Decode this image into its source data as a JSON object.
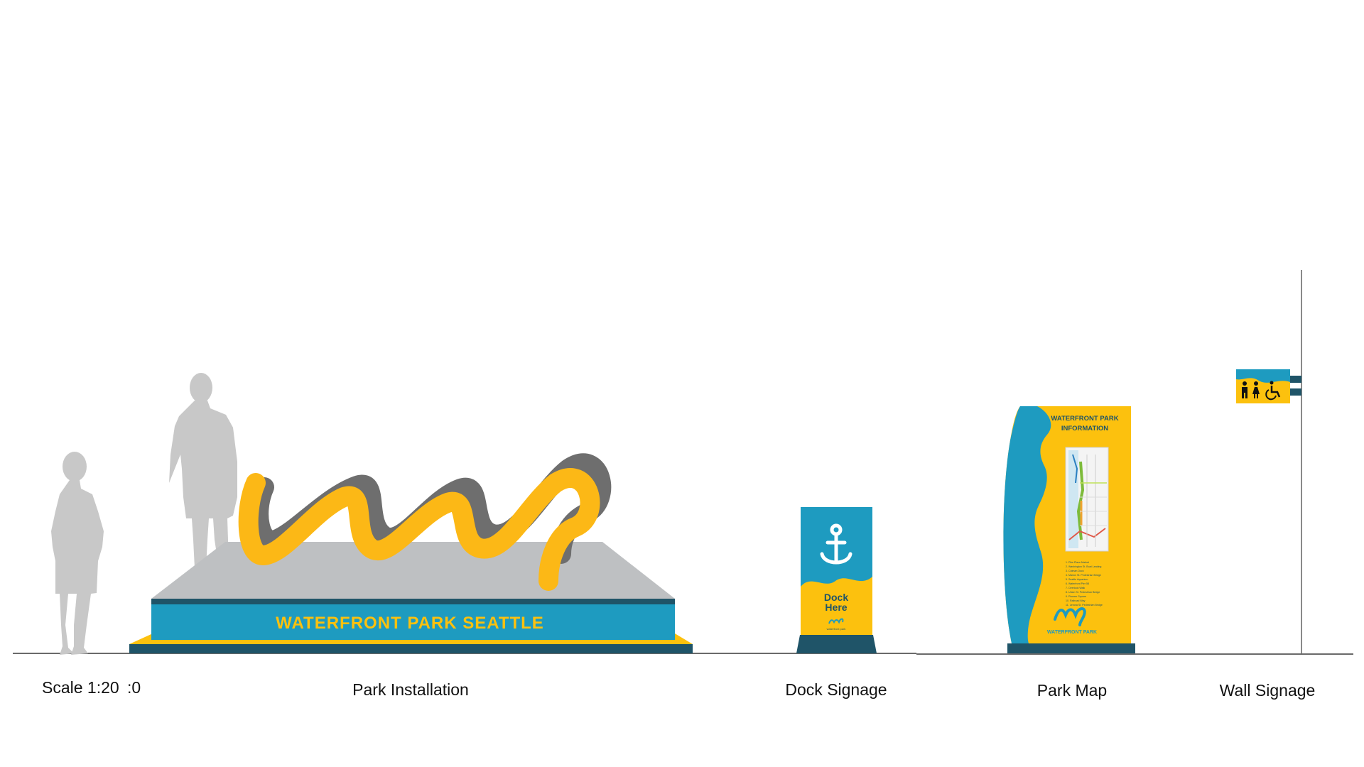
{
  "scale_label": "Scale 1:20",
  "scale_fragment": ":0",
  "captions": {
    "park_installation": "Park Installation",
    "dock_signage": "Dock Signage",
    "park_map": "Park Map",
    "wall_signage": "Wall Signage"
  },
  "installation": {
    "banner_text": "WATERFRONT PARK SEATTLE"
  },
  "dock_sign": {
    "line1": "Dock",
    "line2": "Here",
    "small_logo_caption": "waterfront park"
  },
  "map_kiosk": {
    "title_line1": "WATERFRONT PARK",
    "title_line2": "INFORMATION",
    "logo_caption": "WATERFRONT PARK",
    "legend_items": [
      "1. Pike Place Market",
      "2. Washington St. Boat Landing",
      "3. Colman Dock",
      "4. Marion St. Pedestrian Bridge",
      "5. Seattle Aquarium",
      "6. Waterfront Pier 58",
      "7. Overlook Walk",
      "8. Union St. Pedestrian Bridge",
      "9. Pioneer Square",
      "10. Railroad Way",
      "11. Lenora St. Pedestrian Bridge"
    ]
  },
  "wall_sign": {
    "icons": [
      "male-restroom-icon",
      "female-restroom-icon",
      "accessible-icon"
    ]
  },
  "colors": {
    "yellow": "#FCC10E",
    "blue": "#1E9BC0",
    "navy": "#1F5468",
    "gray_shadow": "#6E6E6E",
    "platform_gray": "#BEC0C2",
    "silhouette": "#C8C8C8"
  }
}
